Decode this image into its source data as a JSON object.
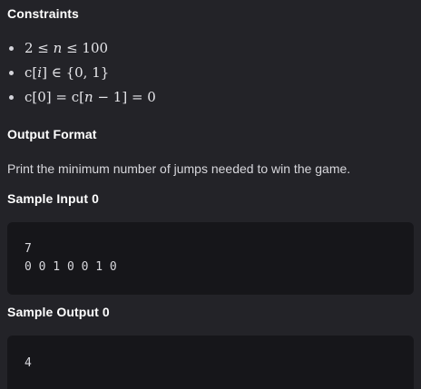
{
  "sections": {
    "constraints_title": "Constraints",
    "output_format_title": "Output Format",
    "output_format_text": "Print the minimum number of jumps needed to win the game.",
    "sample_input_title": "Sample Input 0",
    "sample_output_title": "Sample Output 0"
  },
  "constraints": [
    {
      "parts": [
        "2 ≤ ",
        "n",
        " ≤ 100"
      ]
    },
    {
      "parts": [
        "c[",
        "i",
        "] ∈ {0, 1}"
      ]
    },
    {
      "parts": [
        "c[0] = c[",
        "n",
        " − 1] = 0"
      ]
    }
  ],
  "sample_input": {
    "lines": [
      "7",
      "0 0 1 0 0 1 0"
    ]
  },
  "sample_output": {
    "lines": [
      "4"
    ]
  }
}
